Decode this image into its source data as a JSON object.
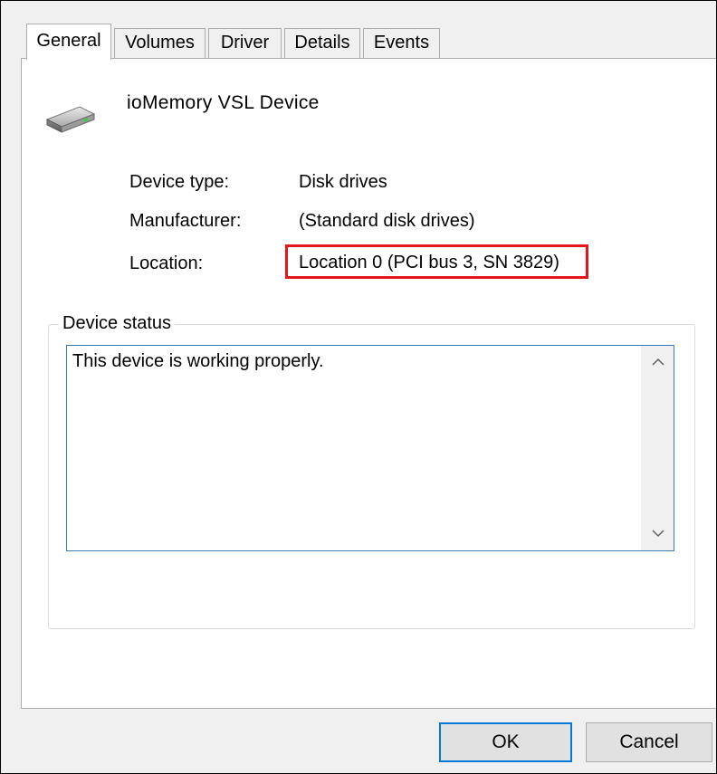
{
  "tabs": [
    {
      "label": "General",
      "active": true
    },
    {
      "label": "Volumes",
      "active": false
    },
    {
      "label": "Driver",
      "active": false
    },
    {
      "label": "Details",
      "active": false
    },
    {
      "label": "Events",
      "active": false
    }
  ],
  "device": {
    "icon": "disk-drive-icon",
    "name": "ioMemory VSL Device"
  },
  "properties": [
    {
      "label": "Device type:",
      "value": "Disk drives"
    },
    {
      "label": "Manufacturer:",
      "value": "(Standard disk drives)"
    },
    {
      "label": "Location:",
      "value": "Location 0 (PCI bus 3, SN 3829)"
    }
  ],
  "highlight": {
    "target": "Location",
    "color": "#e8141b"
  },
  "status": {
    "group_label": "Device status",
    "text": "This device is working properly."
  },
  "buttons": {
    "ok": "OK",
    "cancel": "Cancel"
  },
  "colors": {
    "accent": "#0078d7",
    "highlight": "#e8141b"
  }
}
